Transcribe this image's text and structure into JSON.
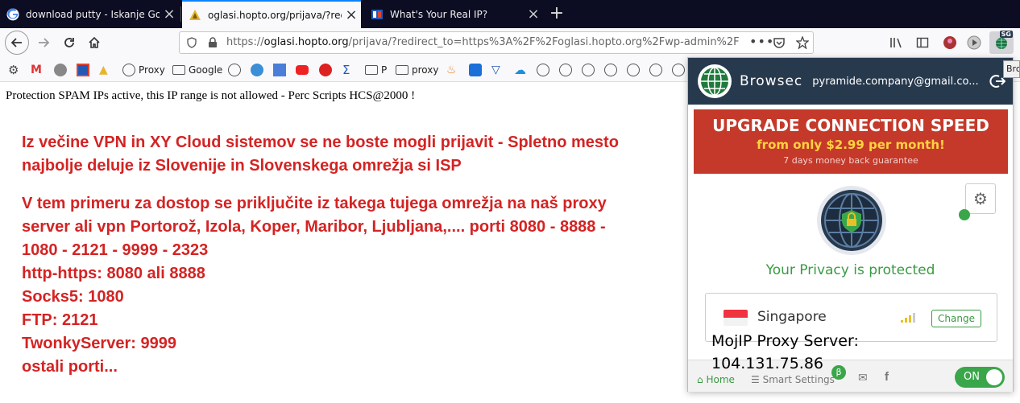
{
  "tabs": [
    {
      "title": "download putty - Iskanje Goog",
      "icon": "google-icon"
    },
    {
      "title": "oglasi.hopto.org/prijava/?redire",
      "icon": "warning-favicon-icon"
    },
    {
      "title": "What's Your Real IP?",
      "icon": "ip-favicon-icon"
    }
  ],
  "newtab_label": "+",
  "url": {
    "prefix": "https://",
    "host": "oglasi.hopto.org",
    "rest": "/prijava/?redirect_to=https%3A%2F%2Foglasi.hopto.org%2Fwp-admin%2F"
  },
  "toolbar": {
    "badge": "SG"
  },
  "bookmarks": [
    {
      "label": "",
      "icon": "gear-icon"
    },
    {
      "label": "",
      "icon": "gmail-icon"
    },
    {
      "label": "",
      "icon": "play-icon"
    },
    {
      "label": "",
      "icon": "grid-icon"
    },
    {
      "label": "",
      "icon": "drive-icon"
    },
    {
      "label": "Proxy",
      "icon": "globe-icon"
    },
    {
      "label": "Google",
      "icon": "folder-icon"
    },
    {
      "label": "",
      "icon": "speedometer-icon"
    },
    {
      "label": "",
      "icon": "earth-icon"
    },
    {
      "label": "",
      "icon": "translate-icon"
    },
    {
      "label": "",
      "icon": "youtube-icon"
    },
    {
      "label": "",
      "icon": "m-icon"
    },
    {
      "label": "",
      "icon": "sum-icon"
    },
    {
      "label": "P",
      "icon": "folder-icon"
    },
    {
      "label": "proxy",
      "icon": "folder-icon"
    }
  ],
  "page": {
    "notice": "Protection SPAM IPs active, this IP range is not allowed - Perc Scripts HCS@2000 !",
    "para1": [
      "Iz večine VPN in XY Cloud sistemov se ne boste mogli prijavit - Spletno mesto",
      "najbolje deluje iz Slovenije in Slovenskega omrežja si ISP"
    ],
    "para2": [
      "V tem primeru za dostop se priključite iz takega tujega omrežja na naš proxy",
      "server ali vpn Portorož, Izola, Koper, Maribor, Ljubljana,.... porti 8080 - 8888 -",
      "1080 - 2121 - 9999 - 2323",
      "http-https: 8080 ali 8888",
      "Socks5: 1080",
      "FTP: 2121",
      "TwonkyServer: 9999",
      "ostali porti..."
    ]
  },
  "browsec": {
    "brand": "Browsec",
    "email": "pyramide.company@gmail.co...",
    "upgrade_title": "UPGRADE CONNECTION SPEED",
    "upgrade_price": "from only $2.99 per month!",
    "upgrade_guarantee": "7 days money back guarantee",
    "privacy": "Your Privacy is protected",
    "country": "Singapore",
    "change": "Change",
    "overlay_line1": "MojIP Proxy Server:",
    "overlay_line2": "104.131.75.86",
    "footer_home": "Home",
    "footer_smart": "Smart Settings",
    "beta": "β",
    "toggle": "ON",
    "colors": {
      "header": "#27394d",
      "upgrade": "#c4392a",
      "accent": "#3aa64a",
      "price": "#ffd23f"
    }
  },
  "tooltip": "Bro"
}
